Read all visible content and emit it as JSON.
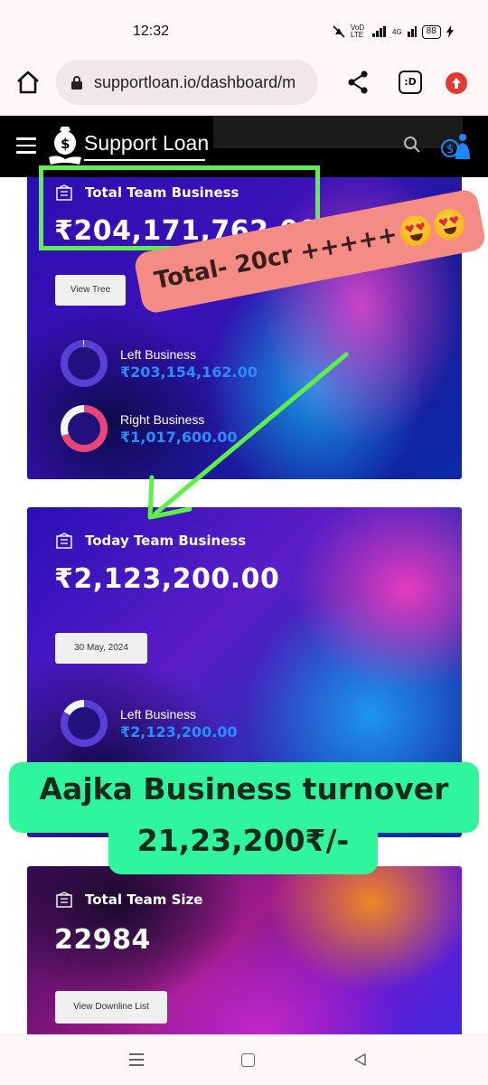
{
  "status_bar": {
    "time": "12:32",
    "network_label_1": "VoD LTE",
    "network_label_2": "4G",
    "battery": "88"
  },
  "browser": {
    "url": "supportloan.io/dashboard/m",
    "tab_switcher_label": ":D"
  },
  "site": {
    "brand": "Support Loan"
  },
  "cards": {
    "total_team_business": {
      "title": "Total Team Business",
      "amount": "₹204,171,762.00",
      "button": "View Tree",
      "left_label": "Left Business",
      "left_value": "₹203,154,162.00",
      "right_label": "Right Business",
      "right_value": "₹1,017,600.00",
      "left_share": 0.995,
      "right_share": 0.005
    },
    "today_team_business": {
      "title": "Today Team Business",
      "amount": "₹2,123,200.00",
      "date_button": "30 May, 2024",
      "left_label": "Left Business",
      "left_value": "₹2,123,200.00"
    },
    "total_team_size": {
      "title": "Total Team Size",
      "count": "22984",
      "button": "View Downline List"
    }
  },
  "overlays": {
    "sticker1": "Total- 20cr +++++",
    "sticker2_line1": "Aajka Business turnover",
    "sticker2_line2": "21,23,200₹/-"
  },
  "colors": {
    "highlight_green": "#5df04a",
    "arrow_green": "#5df04a",
    "sticker1_bg": "#f48b84",
    "sticker2_bg": "#2ff59c",
    "value_blue": "#2a8cff"
  }
}
